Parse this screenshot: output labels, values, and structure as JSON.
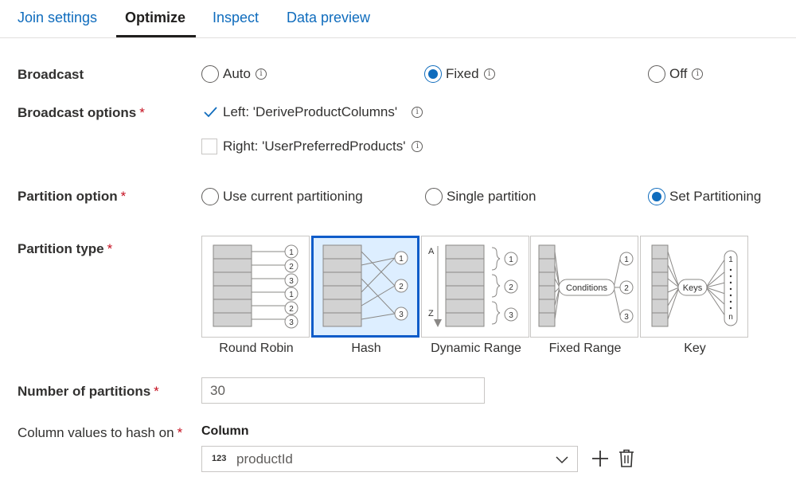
{
  "tabs": [
    {
      "label": "Join settings"
    },
    {
      "label": "Optimize"
    },
    {
      "label": "Inspect"
    },
    {
      "label": "Data preview"
    }
  ],
  "active_tab": "Optimize",
  "broadcast": {
    "label": "Broadcast",
    "options": [
      {
        "label": "Auto",
        "checked": false
      },
      {
        "label": "Fixed",
        "checked": true
      },
      {
        "label": "Off",
        "checked": false
      }
    ]
  },
  "broadcast_options": {
    "label": "Broadcast options",
    "required": "*",
    "left": {
      "label": "Left: 'DeriveProductColumns'",
      "checked": true
    },
    "right": {
      "label": "Right: 'UserPreferredProducts'",
      "checked": false
    }
  },
  "partition_option": {
    "label": "Partition option",
    "required": "*",
    "options": [
      {
        "label": "Use current partitioning",
        "checked": false
      },
      {
        "label": "Single partition",
        "checked": false
      },
      {
        "label": "Set Partitioning",
        "checked": true
      }
    ]
  },
  "partition_type": {
    "label": "Partition type",
    "required": "*",
    "selected": "Hash",
    "tiles": [
      {
        "label": "Round Robin",
        "numbers": [
          "1",
          "2",
          "3",
          "1",
          "2",
          "3"
        ]
      },
      {
        "label": "Hash",
        "numbers": [
          "1",
          "2",
          "3"
        ]
      },
      {
        "label": "Dynamic Range",
        "numbers": [
          "1",
          "2",
          "3"
        ],
        "axis_start": "A",
        "axis_end": "Z"
      },
      {
        "label": "Fixed Range",
        "numbers": [
          "1",
          "2",
          "3"
        ],
        "center": "Conditions"
      },
      {
        "label": "Key",
        "numbers": [
          "1",
          "n"
        ],
        "center": "Keys"
      }
    ]
  },
  "num_partitions": {
    "label": "Number of partitions",
    "required": "*",
    "value": "30"
  },
  "hash_columns": {
    "label": "Column values to hash on",
    "required": "*",
    "column_header": "Column",
    "type_badge": "123",
    "value": "productId",
    "add_icon": "plus-icon",
    "delete_icon": "trash-icon"
  },
  "colors": {
    "accent": "#0f6cbd",
    "selected_tile_border": "#0f5cc9",
    "selected_tile_bg": "#ddeeff",
    "required": "#c50f1f"
  }
}
